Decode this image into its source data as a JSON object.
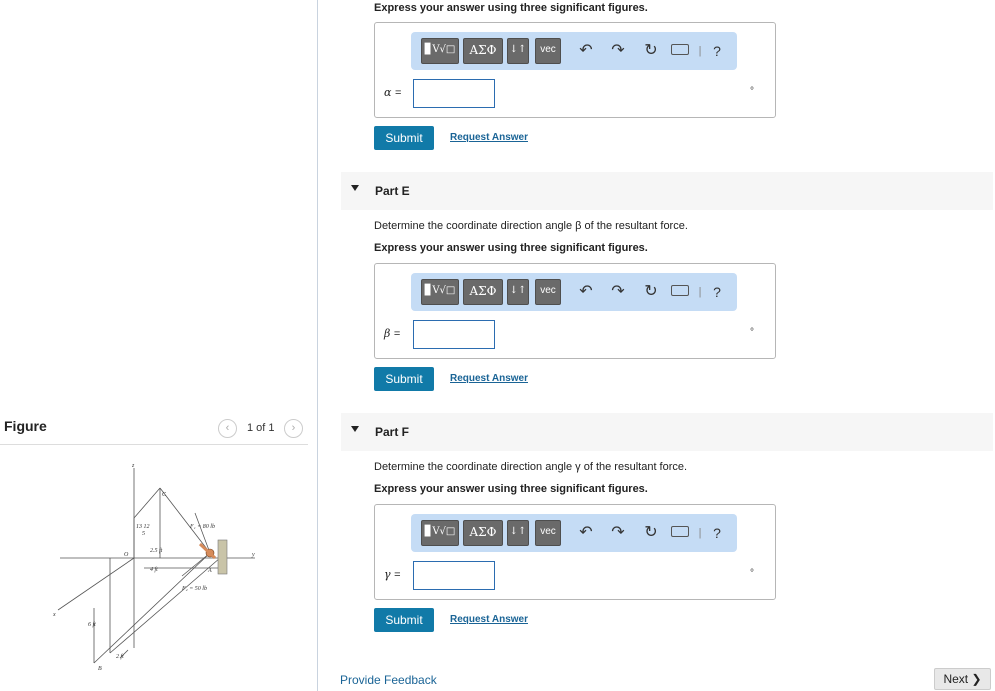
{
  "figure_panel": {
    "title": "Figure",
    "pager_text": "1 of 1",
    "prev_icon": "chevron-left-icon",
    "next_icon": "chevron-right-icon",
    "labels": {
      "z": "z",
      "c": "C",
      "o": "O",
      "x": "x",
      "y": "y",
      "a": "A",
      "b": "B",
      "f1": "F₁ = 80 lb",
      "f2": "F₂ = 50 lb",
      "d25": "2.5 ft",
      "d4": "4 ft",
      "d6": "6 ft",
      "d2": "2 ft",
      "ratio": "13 12",
      "ratio5": "5"
    }
  },
  "top_instruction": "Express your answer using three significant figures.",
  "toolbar": {
    "templates_label": "▊V√□",
    "greek_label": "ΑΣΦ",
    "arrows_label": "↓↑",
    "vec_label": "vec",
    "undo_glyph": "↶",
    "redo_glyph": "↷",
    "reset_glyph": "↻",
    "keyboard_glyph": "⌨",
    "separator": "|",
    "help_label": "?"
  },
  "parts": [
    {
      "name": "",
      "question": "",
      "instruction": "",
      "variable": "α",
      "equals": "=",
      "input_value": "",
      "unit": "°",
      "submit_label": "Submit",
      "request_label": "Request Answer"
    },
    {
      "name": "Part E",
      "question": "Determine the coordinate direction angle β of the resultant force.",
      "instruction": "Express your answer using three significant figures.",
      "variable": "β",
      "equals": "=",
      "input_value": "",
      "unit": "°",
      "submit_label": "Submit",
      "request_label": "Request Answer"
    },
    {
      "name": "Part F",
      "question": "Determine the coordinate direction angle γ of the resultant force.",
      "instruction": "Express your answer using three significant figures.",
      "variable": "γ",
      "equals": "=",
      "input_value": "",
      "unit": "°",
      "submit_label": "Submit",
      "request_label": "Request Answer"
    }
  ],
  "footer": {
    "feedback_label": "Provide Feedback",
    "next_label": "Next ❯"
  }
}
